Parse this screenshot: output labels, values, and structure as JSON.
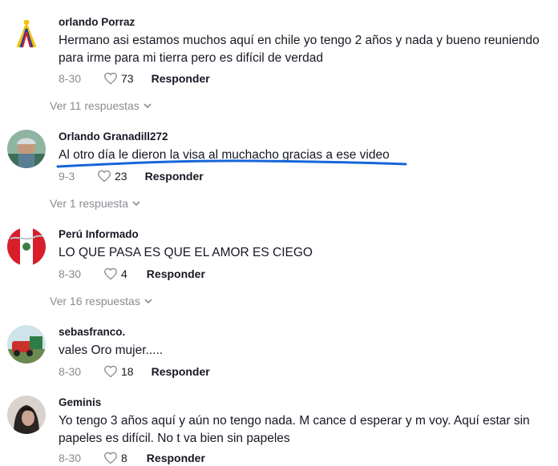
{
  "comments": [
    {
      "username": "orlando Porraz",
      "text": "Hermano asi estamos muchos aquí en chile yo tengo 2 años y nada y bueno reuniendo para irme para mi tierra pero es difícil de verdad",
      "date": "8-30",
      "likes": "73",
      "reply_label": "Responder",
      "replies_label": "Ver 11 respuestas"
    },
    {
      "username": "Orlando Granadill272",
      "text": "Al otro día le dieron la visa al muchacho gracias a ese video",
      "date": "9-3",
      "likes": "23",
      "reply_label": "Responder",
      "replies_label": "Ver 1 respuesta"
    },
    {
      "username": "Perú Informado",
      "text": "LO QUE PASA ES QUE EL AMOR ES CIEGO",
      "date": "8-30",
      "likes": "4",
      "reply_label": "Responder",
      "replies_label": "Ver 16 respuestas"
    },
    {
      "username": "sebasfranco.",
      "text": "vales Oro mujer.....",
      "date": "8-30",
      "likes": "18",
      "reply_label": "Responder"
    },
    {
      "username": "Geminis",
      "text": "Yo tengo 3 años aquí y aún no tengo nada. M cance d esperar y m voy. Aquí estar sin papeles es difícil. No t va bien sin papeles",
      "date": "8-30",
      "likes": "8",
      "reply_label": "Responder"
    }
  ],
  "colors": {
    "text": "#161823",
    "muted": "#8a8b91",
    "annotation": "#1565d8"
  }
}
